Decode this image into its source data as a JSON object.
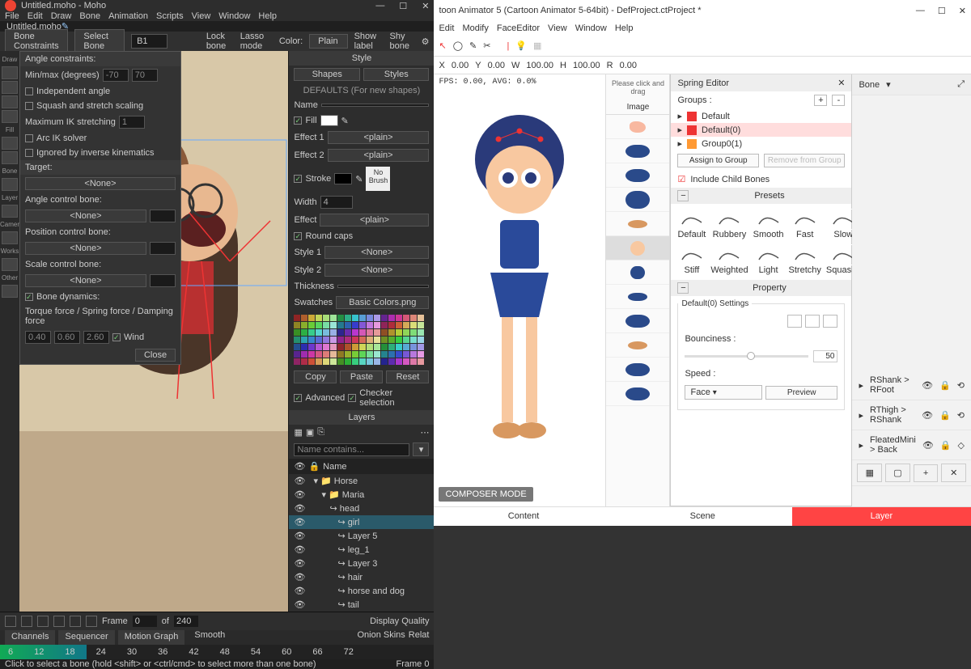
{
  "moho": {
    "window_title": "Untitled.moho - Moho",
    "win_controls": {
      "min": "—",
      "max": "☐",
      "close": "✕"
    },
    "menu": [
      "File",
      "Edit",
      "Draw",
      "Bone",
      "Animation",
      "Scripts",
      "View",
      "Window",
      "Help"
    ],
    "tab_name": "Untitled.moho",
    "optbar": {
      "bone_constraints": "Bone Constraints",
      "select_bone": "Select Bone",
      "bone_val": "B1",
      "lock_bone": "Lock bone",
      "lasso_mode": "Lasso mode",
      "color": "Color:",
      "color_val": "Plain",
      "show_label": "Show label",
      "shy_bone": "Shy bone"
    },
    "tool_sections": [
      "Draw",
      "Fill",
      "Bone",
      "Layer",
      "Camera",
      "Works",
      "Other"
    ],
    "constraints": {
      "angle": "Angle constraints:",
      "minmax": "Min/max (degrees)",
      "min": "-70",
      "max": "70",
      "indep": "Independent angle",
      "squash": "Squash and stretch scaling",
      "maxik": "Maximum IK stretching",
      "maxik_v": "1",
      "arcik": "Arc IK solver",
      "ignore": "Ignored by inverse kinematics",
      "target": "Target:",
      "none": "<None>",
      "angcb": "Angle control bone:",
      "poscb": "Position control bone:",
      "scalecb": "Scale control bone:",
      "bonedyn": "Bone dynamics:",
      "torque": "Torque force / Spring force / Damping force",
      "t": "0.40",
      "s": "0.60",
      "d": "2.60",
      "wind": "Wind",
      "close": "Close"
    },
    "style": {
      "title": "Style",
      "shapes": "Shapes",
      "styles": "Styles",
      "defaults": "DEFAULTS (For new shapes)",
      "name": "Name",
      "fill": "Fill",
      "effect1": "Effect 1",
      "effect2": "Effect 2",
      "plain": "<plain>",
      "stroke": "Stroke",
      "nobrush": "No Brush",
      "width": "Width",
      "width_v": "4",
      "effect": "Effect",
      "roundcaps": "Round caps",
      "style1": "Style 1",
      "style2": "Style 2",
      "none": "<None>",
      "thickness": "Thickness",
      "swatches": "Swatches",
      "palette_name": "Basic Colors.png",
      "copy": "Copy",
      "paste": "Paste",
      "reset": "Reset",
      "advanced": "Advanced",
      "checker": "Checker selection"
    },
    "layers": {
      "title": "Layers",
      "filter": "Name contains...",
      "col": "Name",
      "items": [
        "Horse",
        "Maria",
        "head",
        "girl",
        "Layer 5",
        "leg_1",
        "Layer 3",
        "hair",
        "horse and dog",
        "tail"
      ],
      "selected": "girl"
    },
    "tl": {
      "frame": "Frame",
      "frame_v": "0",
      "of": "of",
      "total": "240",
      "tabs": [
        "Channels",
        "Sequencer",
        "Motion Graph"
      ],
      "smooth": "Smooth",
      "onion": "Onion Skins",
      "relat": "Relat",
      "disp": "Display Quality",
      "ticks": [
        "6",
        "12",
        "18",
        "24",
        "30",
        "36",
        "42",
        "48",
        "54",
        "60",
        "66",
        "72"
      ]
    },
    "status": {
      "left": "Click to select a bone (hold <shift> or <ctrl/cmd> to select more than one bone)",
      "right": "Frame 0"
    }
  },
  "ca": {
    "window_title": "toon Animator 5 (Cartoon Animator 5-64bit) - DefProject.ctProject *",
    "win_controls": {
      "min": "—",
      "max": "☐",
      "close": "✕"
    },
    "menu": [
      "Edit",
      "Modify",
      "FaceEditor",
      "View",
      "Window",
      "Help"
    ],
    "coords": {
      "x": "X",
      "xv": "0.00",
      "y": "Y",
      "yv": "0.00",
      "w": "W",
      "wv": "100.00",
      "h": "H",
      "hv": "100.00",
      "r": "R",
      "rv": "0.00"
    },
    "fps": "FPS: 0.00, AVG: 0.0%",
    "composer": "COMPOSER MODE",
    "mid": {
      "hint": "Please click and drag",
      "image": "Image"
    },
    "spring": {
      "title": "Spring Editor",
      "close": "✕",
      "groups": "Groups :",
      "plus": "+",
      "minus": "-",
      "grouplist": [
        {
          "name": "Default",
          "color": "#e33"
        },
        {
          "name": "Default(0)",
          "color": "#e33",
          "sel": true
        },
        {
          "name": "Group0(1)",
          "color": "#f93"
        }
      ],
      "assign": "Assign to Group",
      "remove": "Remove from Group",
      "include": "Include Child Bones",
      "presets": "Presets",
      "preset_names": [
        "Default",
        "Rubbery",
        "Smooth",
        "Fast",
        "Slow",
        "Stiff",
        "Weighted",
        "Light",
        "Stretchy",
        "Squashy"
      ],
      "property": "Property",
      "settings": "Default(0) Settings",
      "bounciness": "Bounciness :",
      "bounce_v": "50",
      "speed": "Speed :",
      "face": "Face",
      "preview": "Preview"
    },
    "far": {
      "bone": "Bone",
      "rows": [
        "RShank > RFoot",
        "RThigh > RShank",
        "FleatedMini > Back"
      ]
    },
    "tabs": [
      "Content",
      "Scene",
      "Layer"
    ],
    "active": "Layer",
    "buttons": {
      "plus": "+",
      "x": "✕"
    }
  }
}
